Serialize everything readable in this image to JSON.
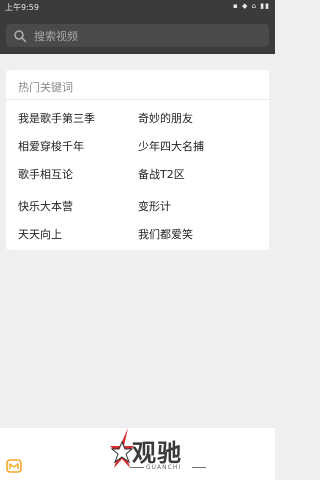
{
  "status_bar": {
    "time": "上午9:59",
    "icons": "▪ ◆ ⌂ ▮▮"
  },
  "search": {
    "placeholder": "搜索视频"
  },
  "hot_keywords": {
    "title": "热门关键词",
    "items": [
      "我是歌手第三季",
      "奇妙的朋友",
      "相爱穿梭千年",
      "少年四大名捕",
      "歌手相互论",
      "备战T2区",
      "快乐大本营",
      "变形计",
      "天天向上",
      "我们都爱笑"
    ]
  },
  "watermark": {
    "text": "观驰",
    "subtext": "GUANCHI"
  },
  "colors": {
    "header_bg": "#3b3b3b",
    "page_bg": "#efeff1",
    "app_icon": "#f5a623"
  }
}
